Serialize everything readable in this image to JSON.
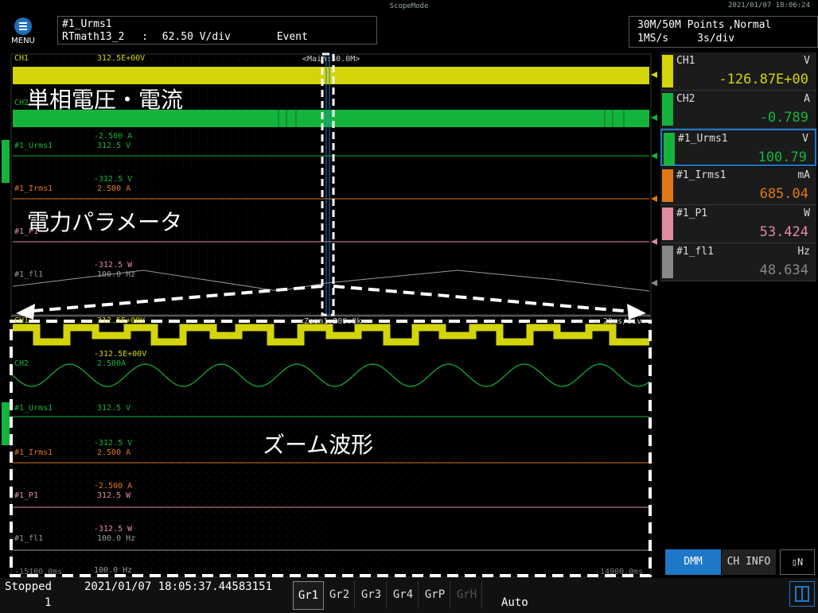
{
  "header": {
    "title": "ScopeMode",
    "datetime": "2021/01/07 18:06:24",
    "menu_label": "MENU",
    "info_line1": "#1_Urms1",
    "info_line2_name": "RTmath13_2",
    "info_line2_sep": ":",
    "info_line2_scale": "62.50 V/div",
    "info_line2_mode": "Event",
    "acq_points": "30M/50M Points",
    "acq_mode": ",Normal",
    "acq_rate": "1MS/s",
    "acq_tdiv": "3s/div"
  },
  "main_wave": {
    "zoom_marker": "<Main:30.0M>",
    "labels": [
      {
        "name": "CH1",
        "value": "312.5E+00V"
      },
      {
        "name": "CH2",
        "value": ""
      },
      {
        "name": "#1_Urms1",
        "value": "312.5 V",
        "neg": "-312.5 V"
      },
      {
        "name": "#1_Irms1",
        "value": "2.500 A"
      },
      {
        "name": "#1_P1",
        "value": "",
        "neg": "-312.5 W"
      },
      {
        "name": "#1_fl1",
        "value": "100.0 Hz"
      }
    ],
    "ch2_neg": "-2.500 A"
  },
  "zoom_wave": {
    "zoom_marker": "<Zoom1:200.0k>",
    "tdiv": "20ms/div",
    "labels": [
      {
        "name": "CH1",
        "value": "312.5E+00V",
        "neg": "-312.5E+00V"
      },
      {
        "name": "CH2",
        "value": "2.500A"
      },
      {
        "name": "#1_Urms1",
        "value": "312.5 V",
        "neg": "-312.5 V"
      },
      {
        "name": "#1_Irms1",
        "value": "2.500 A",
        "neg": "-2.500 A"
      },
      {
        "name": "#1_P1",
        "value": "312.5 W",
        "neg": "-312.5 W"
      },
      {
        "name": "#1_fl1",
        "value": "100.0 Hz",
        "neg": "100.0 Hz"
      }
    ],
    "time_left": "-15100.0ms",
    "time_right": "-14900.0ms"
  },
  "overlay": {
    "voltage_current": "単相電圧・電流",
    "power_params": "電力パラメータ",
    "zoom_waveform": "ズーム波形"
  },
  "measurements": [
    {
      "name": "CH1",
      "unit": "V",
      "value": "-126.87E+00",
      "color": "#d4d40a"
    },
    {
      "name": "CH2",
      "unit": "A",
      "value": "-0.789",
      "color": "#14b43c"
    },
    {
      "name": "#1_Urms1",
      "unit": "V",
      "value": "100.79",
      "color": "#14b43c",
      "selected": true
    },
    {
      "name": "#1_Irms1",
      "unit": "mA",
      "value": "685.04",
      "color": "#e07818"
    },
    {
      "name": "#1_P1",
      "unit": "W",
      "value": "53.424",
      "color": "#e08ca0"
    },
    {
      "name": "#1_fl1",
      "unit": "Hz",
      "value": "48.634",
      "color": "#888888"
    }
  ],
  "buttons": {
    "dmm": "DMM",
    "ch_info": "CH INFO",
    "layout": "N"
  },
  "status": {
    "state": "Stopped",
    "count": "1",
    "trigger_time": "2021/01/07 18:05:37.44583151",
    "trigger_mode": "Auto"
  },
  "groups": [
    {
      "label": "Gr1",
      "active": true
    },
    {
      "label": "Gr2"
    },
    {
      "label": "Gr3"
    },
    {
      "label": "Gr4"
    },
    {
      "label": "GrP"
    },
    {
      "label": "GrH",
      "disabled": true
    }
  ],
  "colors": {
    "ch1": "#d4d40a",
    "ch2": "#14b43c",
    "irms": "#e07818",
    "p1": "#e08ca0",
    "fl": "#888888",
    "accent": "#1e78c8"
  }
}
